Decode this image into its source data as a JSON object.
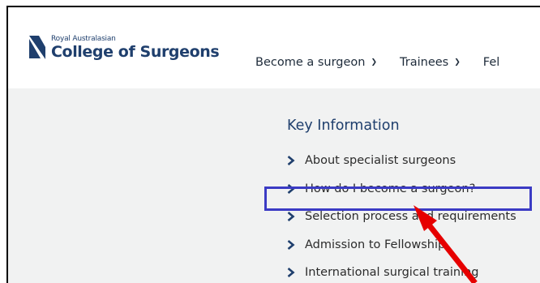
{
  "logo": {
    "small_text": "Royal Australasian",
    "big_text": "College of Surgeons"
  },
  "nav": {
    "items": [
      {
        "label": "Become a surgeon",
        "icon": "chevron-down-icon"
      },
      {
        "label": "Trainees",
        "icon": "chevron-down-icon"
      },
      {
        "label": "Fel"
      }
    ]
  },
  "key_information": {
    "title": "Key Information",
    "items": [
      {
        "label": "About specialist surgeons"
      },
      {
        "label": "How do I become a surgeon?"
      },
      {
        "label": "Selection process and requirements",
        "highlighted": true
      },
      {
        "label": "Admission to Fellowship"
      },
      {
        "label": "International surgical training"
      }
    ]
  },
  "colors": {
    "brand": "#1f3f6d",
    "highlight_border": "#3b3bc4",
    "annotation_arrow": "#e60000",
    "content_background": "#f1f2f2"
  }
}
